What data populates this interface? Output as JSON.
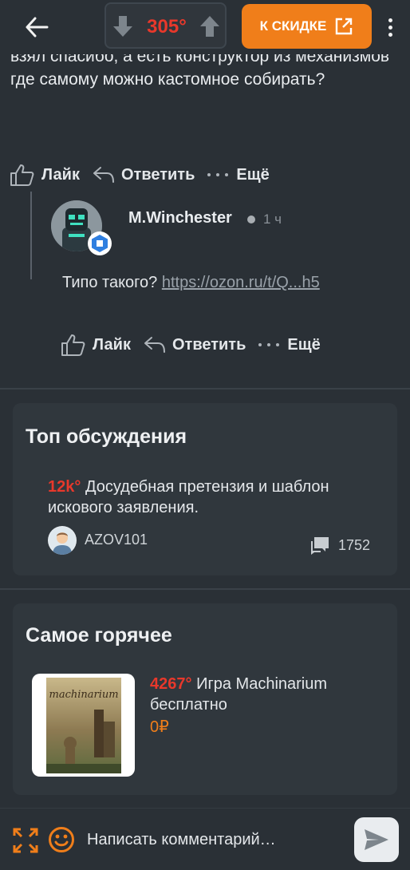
{
  "topbar": {
    "temperature": "305°",
    "deal_button_label": "К СКИДКЕ"
  },
  "comment": {
    "text": "взял спасибо, а есть конструктор из механизмов где самому можно кастомное собирать?",
    "actions": {
      "like": "Лайк",
      "reply": "Ответить",
      "more": "Ещё"
    }
  },
  "reply": {
    "author": "M.Winchester",
    "time": "1 ч",
    "text_prefix": "Типо такого?",
    "link": "https://ozon.ru/t/Q...h5",
    "actions": {
      "like": "Лайк",
      "reply": "Ответить",
      "more": "Ещё"
    }
  },
  "top_discussions": {
    "title": "Топ обсуждения",
    "item": {
      "temperature": "12k°",
      "title": "Досудебная претензия и шаблон искового заявления.",
      "author": "AZOV101",
      "comments": "1752"
    }
  },
  "hottest": {
    "title": "Самое горячее",
    "item": {
      "temperature": "4267°",
      "title": "Игра Machinarium бесплатно",
      "price": "0₽",
      "image_text": "machinarium"
    }
  },
  "composer": {
    "placeholder": "Написать комментарий…"
  },
  "colors": {
    "background": "#2a3036",
    "card": "#30373d",
    "accent": "#f07e1a",
    "hot": "#e8382b"
  }
}
